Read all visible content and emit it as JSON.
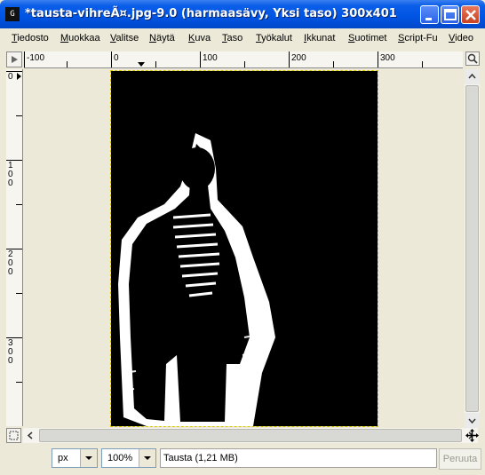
{
  "window": {
    "title": "*tausta-vihreÃ¤.jpg-9.0 (harmaasävy, Yksi taso) 300x401",
    "icon_text": "G"
  },
  "menu": [
    "Tiedosto",
    "Muokkaa",
    "Valitse",
    "Näytä",
    "Kuva",
    "Taso",
    "Työkalut",
    "Ikkunat",
    "Suotimet",
    "Script-Fu",
    "Video"
  ],
  "ruler": {
    "h_labels": [
      "-100",
      "0",
      "100",
      "200",
      "300"
    ],
    "v_labels": [
      "0",
      "1\n0\n0",
      "2\n0\n0",
      "3\n0\n0"
    ]
  },
  "status": {
    "unit": "px",
    "zoom": "100%",
    "message": "Tausta (1,21 MB)",
    "cancel_label": "Peruuta"
  },
  "icons": {
    "title": "gimp-icon",
    "minimize": "minimize-icon",
    "maximize": "maximize-icon",
    "close": "close-icon"
  }
}
